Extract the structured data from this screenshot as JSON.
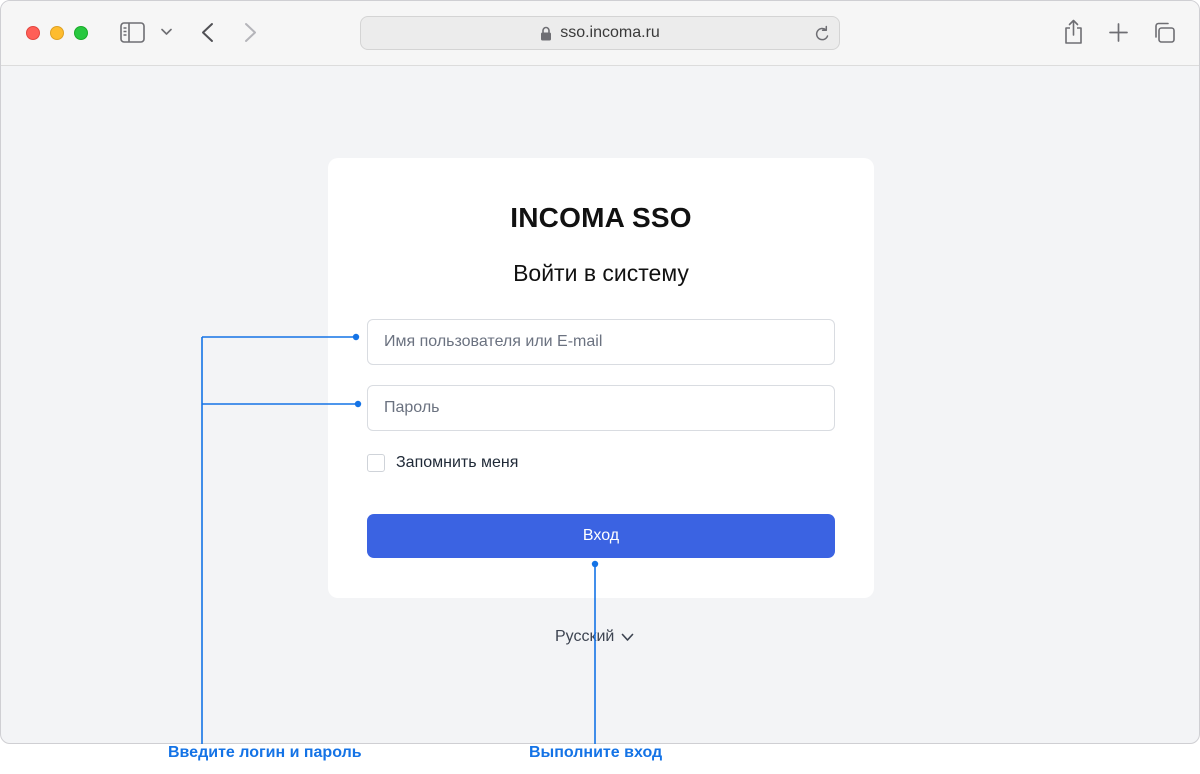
{
  "browser": {
    "url": "sso.incoma.ru",
    "icons": {
      "sidebar": "sidebar-icon",
      "dropdown": "chevron-down-icon",
      "back": "chevron-left-icon",
      "forward": "chevron-right-icon",
      "lock": "lock-icon",
      "reload": "reload-icon",
      "share": "share-icon",
      "new_tab": "plus-icon",
      "tabs_overview": "tabs-icon"
    }
  },
  "login": {
    "title": "INCOMA SSO",
    "subtitle": "Войти в систему",
    "username_placeholder": "Имя пользователя или E-mail",
    "username_value": "",
    "password_placeholder": "Пароль",
    "password_value": "",
    "remember_label": "Запомнить меня",
    "remember_checked": false,
    "submit_label": "Вход"
  },
  "language": {
    "selected": "Русский"
  },
  "annotations": {
    "login_hint": "Введите логин и пароль",
    "submit_hint": "Выполните вход",
    "color": "#1473e6"
  },
  "colors": {
    "accent": "#3b63e2",
    "page_background": "#f3f4f6",
    "card_background": "#ffffff"
  }
}
